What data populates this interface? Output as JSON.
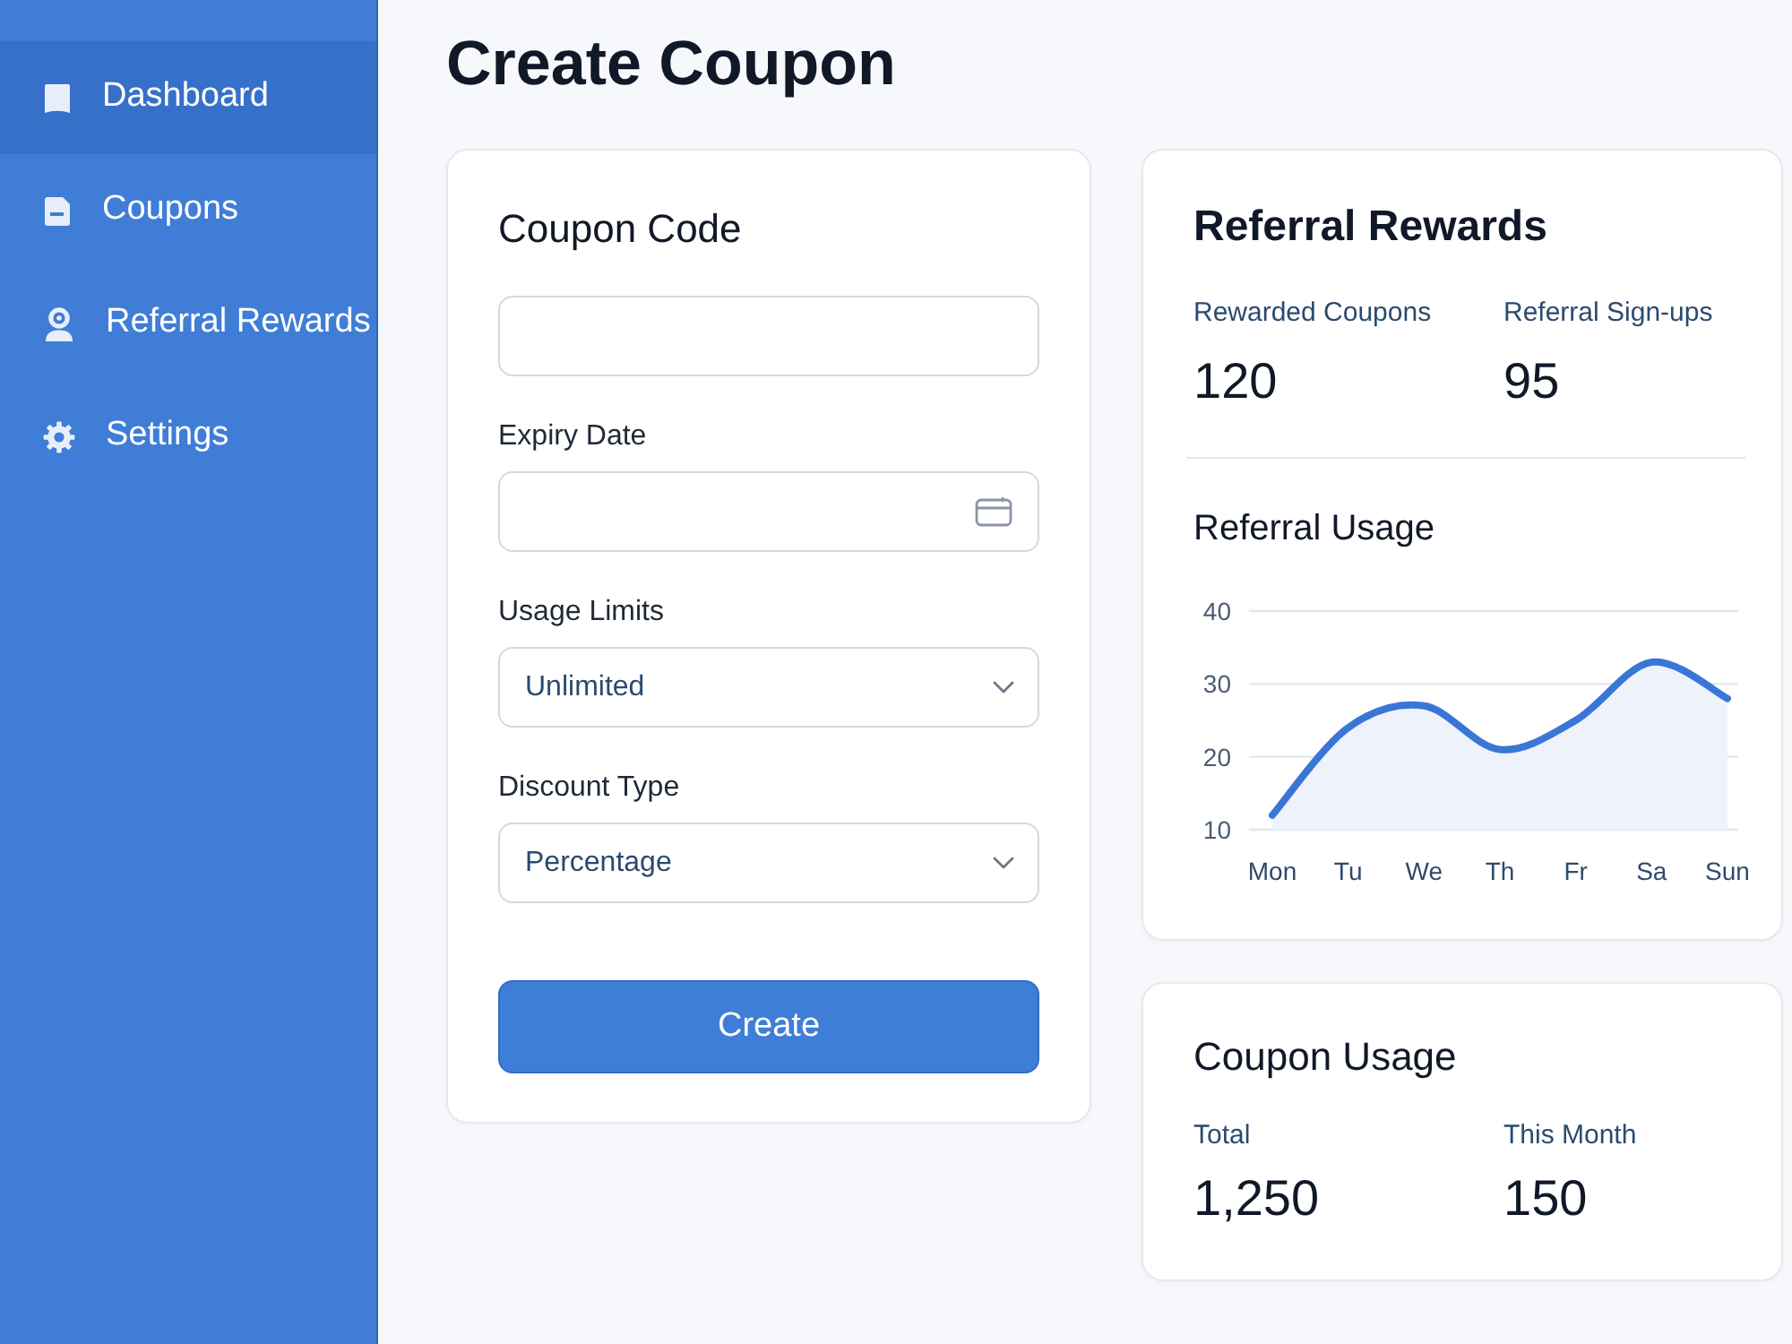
{
  "sidebar": {
    "items": [
      {
        "label": "Dashboard",
        "selected": true
      },
      {
        "label": "Coupons",
        "selected": false
      },
      {
        "label": "Referral Rewards",
        "selected": false
      },
      {
        "label": "Settings",
        "selected": false
      }
    ]
  },
  "page": {
    "title": "Create Coupon"
  },
  "coupon_form": {
    "title": "Coupon Code",
    "fields": [
      {
        "kind": "text"
      },
      {
        "kind": "date",
        "label": "Expiry Date"
      },
      {
        "kind": "select",
        "label": "Usage Limits",
        "value": "Unlimited"
      },
      {
        "kind": "select",
        "label": "Discount Type",
        "value": "Percentage"
      }
    ],
    "submit_button": "Create"
  },
  "referral_rewards": {
    "title": "Referral Rewards",
    "stats": [
      {
        "label": "Rewarded Coupons",
        "value": "120"
      },
      {
        "label": "Referral Sign-ups",
        "value": "95"
      }
    ],
    "chart_data": {
      "type": "area",
      "title": "Referral Usage",
      "categories": [
        "Mon",
        "Tu",
        "We",
        "Th",
        "Fr",
        "Sa",
        "Sun"
      ],
      "series": [
        {
          "color": "#3a76d6",
          "values": [
            12,
            24,
            27,
            21,
            25,
            33,
            28
          ]
        }
      ],
      "ylim": [
        10,
        40
      ],
      "yticks": [
        10,
        20,
        30,
        40
      ]
    }
  },
  "coupon_usage": {
    "title": "Coupon Usage",
    "stats": [
      {
        "label": "Total",
        "value": "1,250"
      },
      {
        "label": "This Month",
        "value": "150"
      }
    ]
  }
}
